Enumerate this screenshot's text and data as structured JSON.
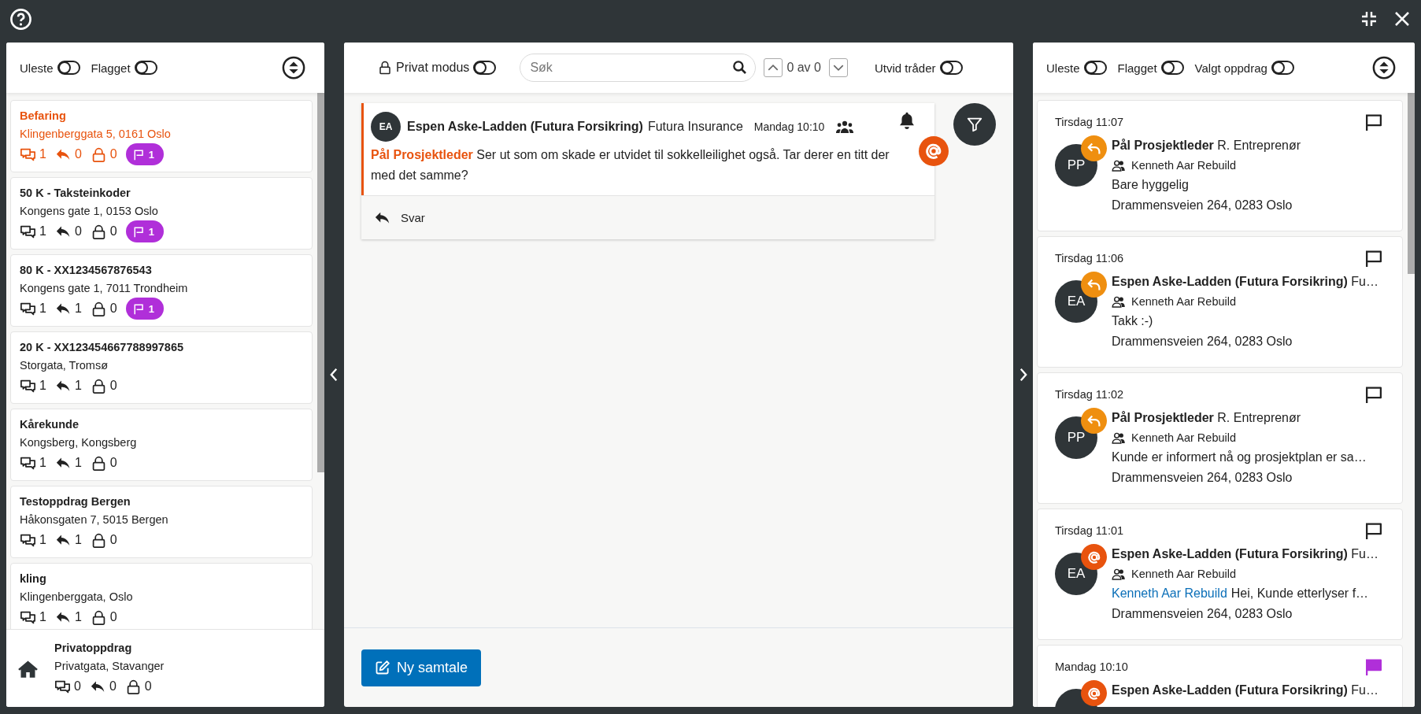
{
  "left_panel": {
    "filters": [
      {
        "label": "Uleste",
        "on": false
      },
      {
        "label": "Flagget",
        "on": false
      }
    ],
    "assignments": [
      {
        "title": "Befaring",
        "address": "Klingenberggata 5, 0161 Oslo",
        "messages": "1",
        "replies": "0",
        "private": "0",
        "flags": "1",
        "selected": true
      },
      {
        "title": "50 K - Taksteinkoder",
        "address": "Kongens gate 1, 0153 Oslo",
        "messages": "1",
        "replies": "0",
        "private": "0",
        "flags": "1",
        "selected": false
      },
      {
        "title": "80 K - XX1234567876543",
        "address": "Kongens gate 1, 7011 Trondheim",
        "messages": "1",
        "replies": "1",
        "private": "0",
        "flags": "1",
        "selected": false
      },
      {
        "title": "20 K - XX123454667788997865",
        "address": "Storgata, Tromsø",
        "messages": "1",
        "replies": "1",
        "private": "0",
        "selected": false
      },
      {
        "title": "Kårekunde",
        "address": "Kongsberg, Kongsberg",
        "messages": "1",
        "replies": "1",
        "private": "0",
        "selected": false
      },
      {
        "title": "Testoppdrag Bergen",
        "address": "Håkonsgaten 7, 5015 Bergen",
        "messages": "1",
        "replies": "1",
        "private": "0",
        "selected": false
      },
      {
        "title": "kling",
        "address": "Klingenberggata, Oslo",
        "messages": "1",
        "replies": "1",
        "private": "0",
        "selected": false
      }
    ],
    "private_assignment": {
      "title": "Privatoppdrag",
      "address": "Privatgata, Stavanger",
      "messages": "0",
      "replies": "0",
      "private": "0"
    }
  },
  "conversation": {
    "private_mode": {
      "label": "Privat modus",
      "on": false
    },
    "search": {
      "placeholder": "Søk"
    },
    "match_count": "0 av 0",
    "expand_threads": {
      "label": "Utvid tråder",
      "on": false
    },
    "messages": [
      {
        "initials": "EA",
        "sender": "Espen Aske-Ladden (Futura Forsikring)",
        "organization": "Futura Insurance",
        "time": "Mandag 10:10",
        "mention": "Pål Prosjektleder",
        "text": "Ser ut som om skade er utvidet til sokkelleilighet også. Tar derer en titt der med det samme?",
        "reply_label": "Svar"
      }
    ],
    "new_button": "Ny samtale"
  },
  "notifications": {
    "filters": [
      {
        "label": "Uleste",
        "on": false
      },
      {
        "label": "Flagget",
        "on": false
      },
      {
        "label": "Valgt oppdrag",
        "on": false
      }
    ],
    "items": [
      {
        "time": "Tirsdag 11:07",
        "initials": "PP",
        "kind": "reply",
        "sender": "Pål Prosjektleder",
        "organization": "R. Entreprenør",
        "group": "Kenneth Aar Rebuild",
        "text": "Bare hyggelig",
        "address": "Drammensveien 264, 0283 Oslo",
        "flagged": false
      },
      {
        "time": "Tirsdag 11:06",
        "initials": "EA",
        "kind": "reply",
        "sender": "Espen Aske-Ladden (Futura Forsikring)",
        "organization": "Fu…",
        "group": "Kenneth Aar Rebuild",
        "text": "Takk :-)",
        "address": "Drammensveien 264, 0283 Oslo",
        "flagged": false
      },
      {
        "time": "Tirsdag 11:02",
        "initials": "PP",
        "kind": "reply",
        "sender": "Pål Prosjektleder",
        "organization": "R. Entreprenør",
        "group": "Kenneth Aar Rebuild",
        "text": "Kunde er informert nå og prosjektplan er sa…",
        "address": "Drammensveien 264, 0283 Oslo",
        "flagged": false
      },
      {
        "time": "Tirsdag 11:01",
        "initials": "EA",
        "kind": "mention",
        "sender": "Espen Aske-Ladden (Futura Forsikring)",
        "organization": "Fu…",
        "group": "Kenneth Aar Rebuild",
        "mention": "Kenneth Aar Rebuild",
        "text": "Hei, Kunde etterlyser f…",
        "address": "Drammensveien 264, 0283 Oslo",
        "flagged": false
      },
      {
        "time": "Mandag 10:10",
        "kind": "mention",
        "sender": "Espen Aske-Ladden (Futura Forsikring)",
        "organization": "Fu…",
        "flagged": true
      }
    ]
  }
}
